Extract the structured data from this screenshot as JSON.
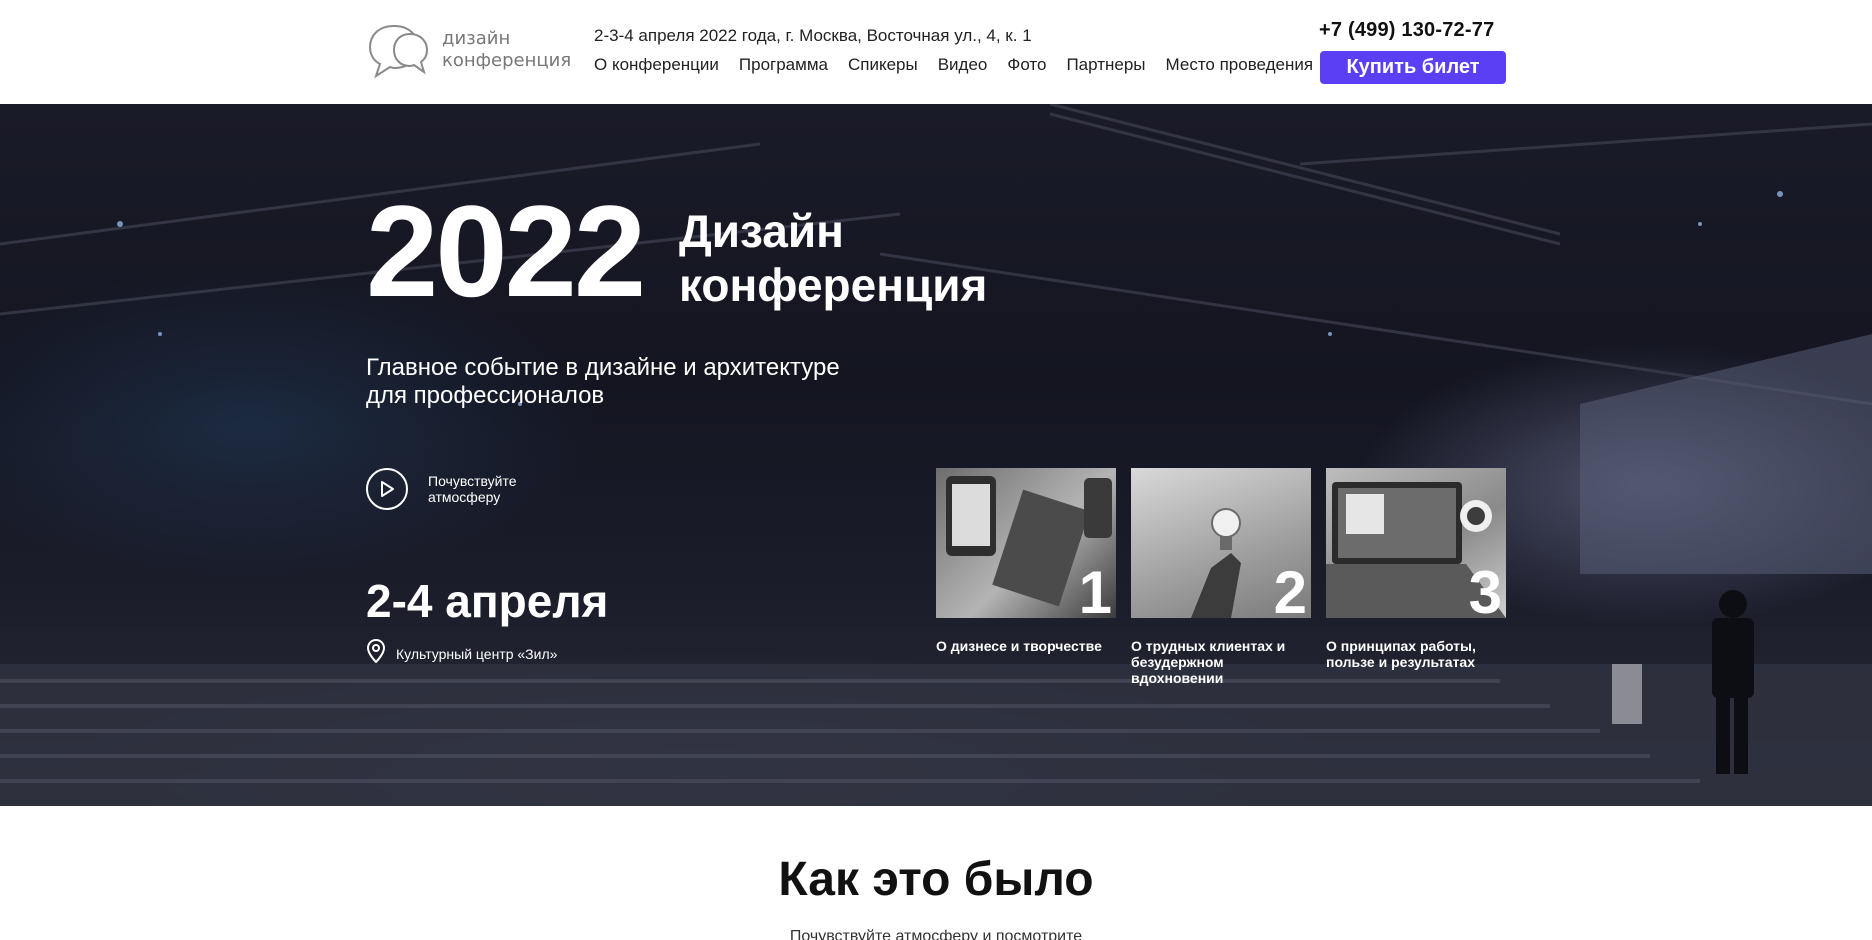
{
  "header": {
    "logo": {
      "line1": "дизайн",
      "line2": "конференция"
    },
    "info": "2-3-4 апреля 2022 года, г. Москва, Восточная ул., 4, к. 1",
    "nav": [
      "О конференции",
      "Программа",
      "Спикеры",
      "Видео",
      "Фото",
      "Партнеры",
      "Место проведения"
    ],
    "phone": "+7 (499) 130-72-77",
    "buy_label": "Купить билет"
  },
  "hero": {
    "year": "2022",
    "title_line1": "Дизайн",
    "title_line2": "конференция",
    "subtitle_line1": "Главное событие в дизайне и архитектуре",
    "subtitle_line2": "для профессионалов",
    "play_line1": "Почувствуйте",
    "play_line2": "атмосферу",
    "date": "2-4 апреля",
    "venue": "Культурный центр «Зил»",
    "cards": [
      {
        "number": "1",
        "label": "О дизнесе и творчестве"
      },
      {
        "number": "2",
        "label": "О трудных клиентах и безудержном вдохновении"
      },
      {
        "number": "3",
        "label": "О принципах работы, пользе и результатах"
      }
    ]
  },
  "section": {
    "title": "Как это было",
    "subtitle": "Почувствуйте атмосферу и посмотрите"
  },
  "colors": {
    "accent": "#5a3ff5",
    "hero_bg": "#151622"
  },
  "icons": [
    "chat-bubbles-logo-icon",
    "play-icon",
    "location-pin-icon"
  ]
}
